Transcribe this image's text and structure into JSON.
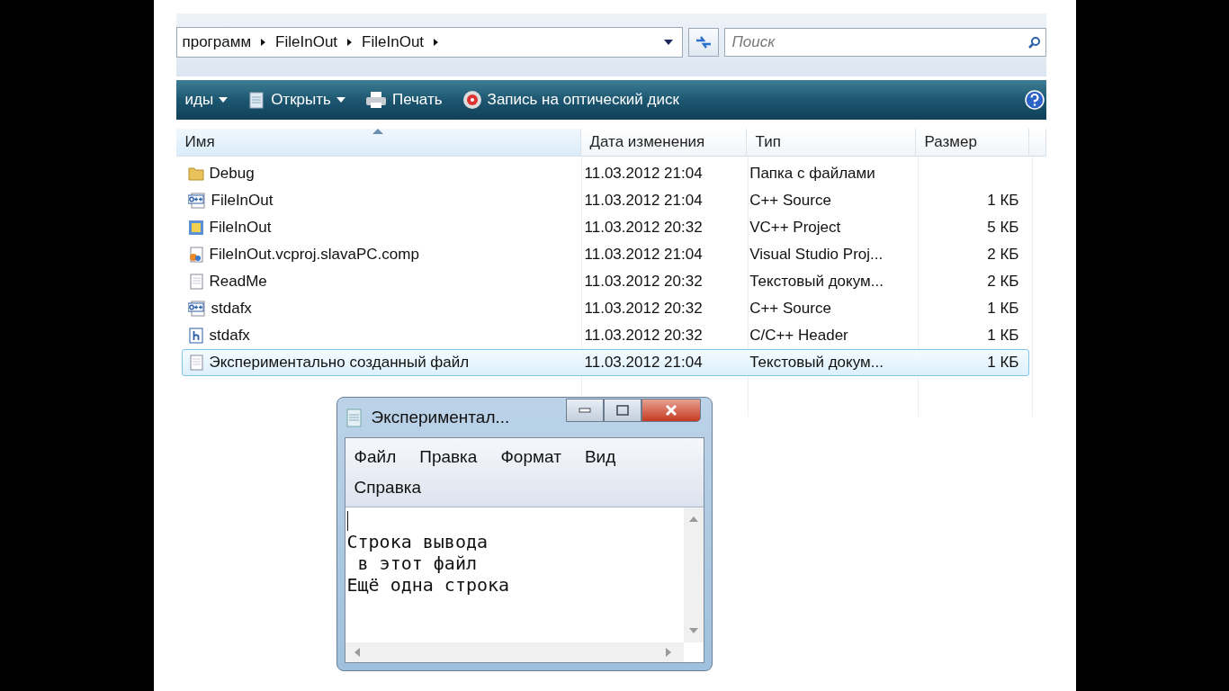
{
  "explorer": {
    "breadcrumb": [
      "программ",
      "FileInOut",
      "FileInOut"
    ],
    "search": {
      "placeholder": "Поиск"
    },
    "toolbar": [
      {
        "kind": "views",
        "label": "иды",
        "dropdown": true
      },
      {
        "kind": "open",
        "label": "Открыть",
        "dropdown": true
      },
      {
        "kind": "print",
        "label": "Печать",
        "dropdown": false
      },
      {
        "kind": "burn",
        "label": "Запись на оптический диск",
        "dropdown": false
      }
    ],
    "columns": [
      {
        "label": "Имя",
        "sorted": true
      },
      {
        "label": "Дата изменения",
        "sorted": false
      },
      {
        "label": "Тип",
        "sorted": false
      },
      {
        "label": "Размер",
        "sorted": false
      }
    ],
    "rows": [
      {
        "kind": "folder",
        "name": "Debug",
        "date": "11.03.2012 21:04",
        "type": "Папка с файлами",
        "size": "",
        "selected": false
      },
      {
        "kind": "cpp",
        "name": "FileInOut",
        "date": "11.03.2012 21:04",
        "type": "C++ Source",
        "size": "1 КБ",
        "selected": false
      },
      {
        "kind": "project",
        "name": "FileInOut",
        "date": "11.03.2012 20:32",
        "type": "VC++ Project",
        "size": "5 КБ",
        "selected": false
      },
      {
        "kind": "user",
        "name": "FileInOut.vcproj.slavaPC.comp",
        "date": "11.03.2012 21:04",
        "type": "Visual Studio Proj...",
        "size": "2 КБ",
        "selected": false
      },
      {
        "kind": "text",
        "name": "ReadMe",
        "date": "11.03.2012 20:32",
        "type": "Текстовый докум...",
        "size": "2 КБ",
        "selected": false
      },
      {
        "kind": "cpp",
        "name": "stdafx",
        "date": "11.03.2012 20:32",
        "type": "C++ Source",
        "size": "1 КБ",
        "selected": false
      },
      {
        "kind": "header",
        "name": "stdafx",
        "date": "11.03.2012 20:32",
        "type": "C/C++ Header",
        "size": "1 КБ",
        "selected": false
      },
      {
        "kind": "text",
        "name": "Экспериментально созданный файл",
        "date": "11.03.2012 21:04",
        "type": "Текстовый докум...",
        "size": "1 КБ",
        "selected": true
      }
    ]
  },
  "notepad": {
    "title": "Экспериментал...",
    "menu": [
      [
        "Файл",
        "Правка",
        "Формат",
        "Вид"
      ],
      [
        "Справка"
      ]
    ],
    "lines": [
      "Строка вывода",
      " в этот файл",
      "Ещё одна строка"
    ]
  }
}
